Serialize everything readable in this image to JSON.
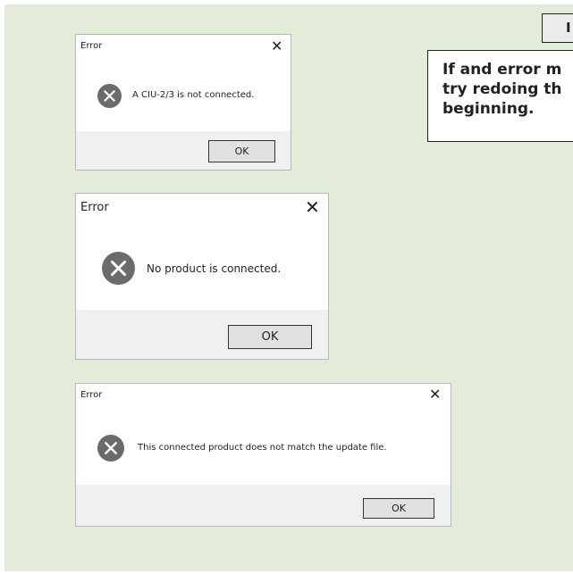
{
  "badge": {
    "label": "I"
  },
  "note": {
    "lines": [
      "If and error m",
      "try redoing th",
      "beginning."
    ]
  },
  "dialogs": [
    {
      "title": "Error",
      "close_label": "✕",
      "icon": "error-circle-x-icon",
      "message": "A CIU-2/3 is not connected.",
      "ok_label": "OK"
    },
    {
      "title": "Error",
      "close_label": "✕",
      "icon": "error-circle-x-icon",
      "message": "No product is connected.",
      "ok_label": "OK"
    },
    {
      "title": "Error",
      "close_label": "✕",
      "icon": "error-circle-x-icon",
      "message": "This connected product does not match the update file.",
      "ok_label": "OK"
    }
  ],
  "colors": {
    "panel_background": "#e2ecd8",
    "dialog_background": "#ffffff",
    "dialog_footer": "#f0f0f0",
    "error_icon": "#6b6b6b",
    "button_face": "#e1e1e1"
  }
}
